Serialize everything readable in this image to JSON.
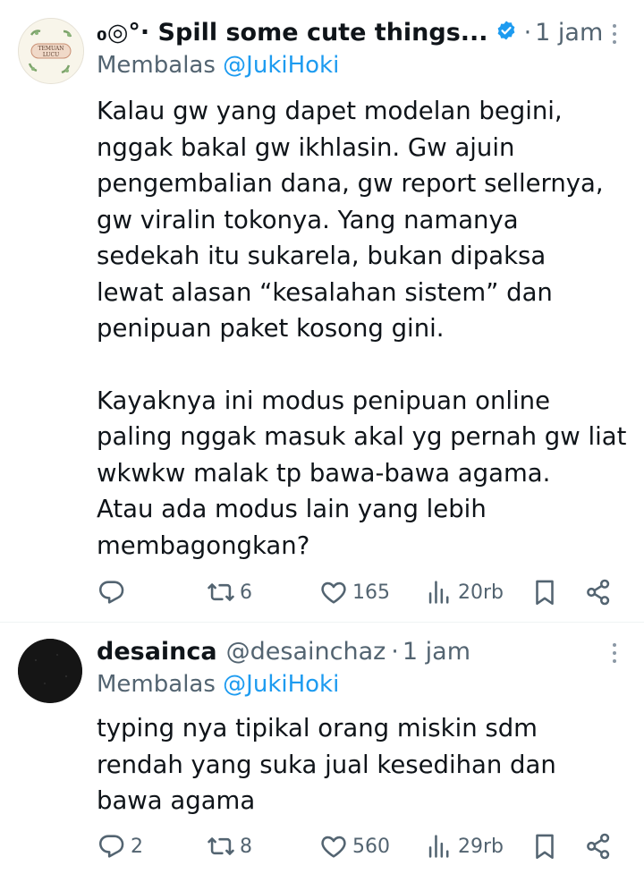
{
  "tweets": [
    {
      "author_name": "₀◎°· Spill some cute things...",
      "handle": "",
      "time": "1 jam",
      "replying_prefix": "Membalas ",
      "replying_to": "@JukiHoki",
      "avatar_text": "TEMUAN LUCU",
      "paragraph1": "Kalau gw yang dapet modelan begini,\nnggak bakal gw ikhlasin. Gw ajuin\npengembalian dana, gw report sellernya,\ngw viralin tokonya. Yang namanya\nsedekah itu sukarela, bukan dipaksa\nlewat alasan “kesalahan sistem” dan\npenipuan paket kosong gini.",
      "paragraph2": "Kayaknya ini modus penipuan online\npaling nggak masuk akal yg pernah gw liat\nwkwkw malak tp bawa-bawa agama.\nAtau ada modus lain yang lebih\nmembagongkan?",
      "stats": {
        "replies": "",
        "reposts": "6",
        "likes": "165",
        "views": "20rb"
      }
    },
    {
      "author_name": "desainca",
      "handle": "@desainchaz",
      "time": "1 jam",
      "replying_prefix": "Membalas ",
      "replying_to": "@JukiHoki",
      "paragraph1": "typing nya tipikal orang miskin sdm\nrendah yang suka jual kesedihan dan\nbawa agama",
      "stats": {
        "replies": "2",
        "reposts": "8",
        "likes": "560",
        "views": "29rb"
      }
    }
  ],
  "colors": {
    "text": "#0f1419",
    "secondary": "#536471",
    "accent": "#1d9bf0"
  },
  "icons": [
    "verified-badge-icon",
    "more-options-icon",
    "reply-icon",
    "repost-icon",
    "like-icon",
    "views-icon",
    "bookmark-icon",
    "share-icon"
  ]
}
